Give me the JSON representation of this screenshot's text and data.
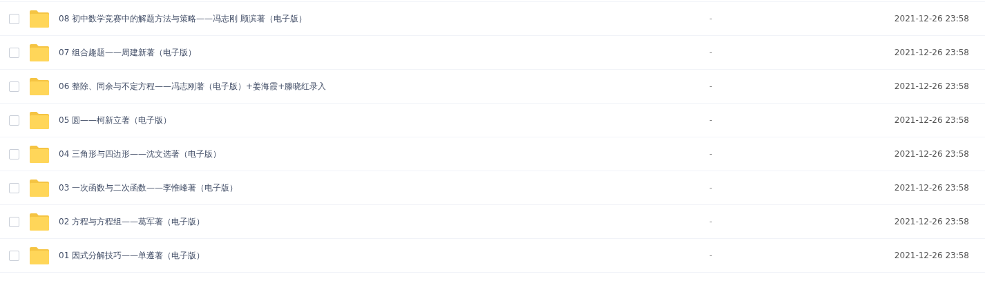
{
  "files": [
    {
      "name": "08 初中数学竞赛中的解题方法与策略——冯志刚 顾滨著（电子版）",
      "size": "-",
      "modified": "2021-12-26 23:58",
      "checked": false
    },
    {
      "name": "07 组合趣题——周建新著（电子版）",
      "size": "-",
      "modified": "2021-12-26 23:58",
      "checked": false
    },
    {
      "name": "06 整除、同余与不定方程——冯志刚著（电子版）+姜海霞+滕晓红录入",
      "size": "-",
      "modified": "2021-12-26 23:58",
      "checked": false
    },
    {
      "name": "05 圆——柯新立著（电子版）",
      "size": "-",
      "modified": "2021-12-26 23:58",
      "checked": false
    },
    {
      "name": "04 三角形与四边形——沈文选著（电子版）",
      "size": "-",
      "modified": "2021-12-26 23:58",
      "checked": false
    },
    {
      "name": "03 一次函数与二次函数——李惟峰著（电子版）",
      "size": "-",
      "modified": "2021-12-26 23:58",
      "checked": false
    },
    {
      "name": "02 方程与方程组——葛军著（电子版）",
      "size": "-",
      "modified": "2021-12-26 23:58",
      "checked": false
    },
    {
      "name": "01 因式分解技巧——单遵著（电子版）",
      "size": "-",
      "modified": "2021-12-26 23:58",
      "checked": false
    }
  ]
}
